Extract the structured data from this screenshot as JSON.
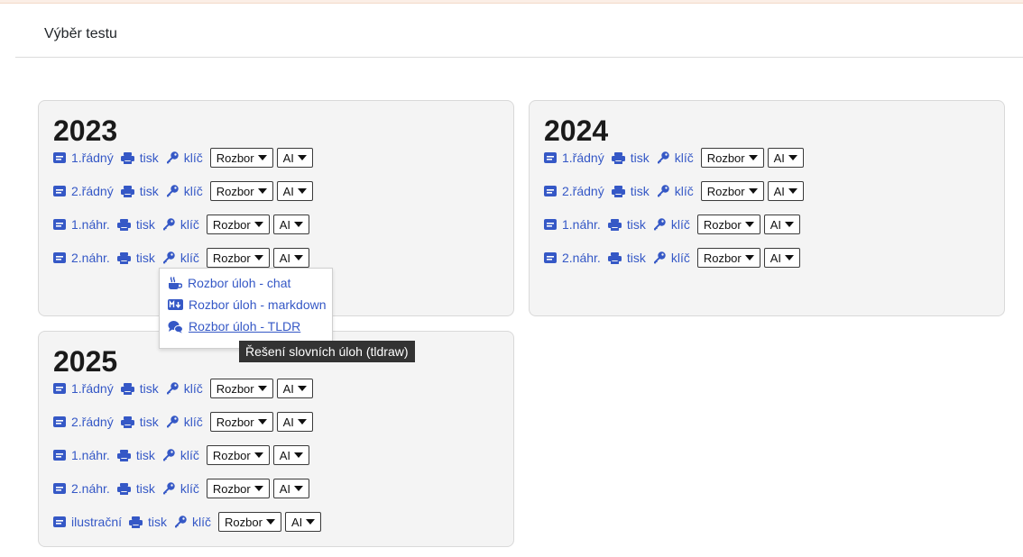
{
  "page": {
    "title": "Výběr testu"
  },
  "labels": {
    "tisk": "tisk",
    "klic": "klíč",
    "rozbor": "Rozbor",
    "ai": "AI"
  },
  "years": {
    "y2023": {
      "year": "2023",
      "tests": [
        "1.řádný",
        "2.řádný",
        "1.náhr.",
        "2.náhr."
      ]
    },
    "y2024": {
      "year": "2024",
      "tests": [
        "1.řádný",
        "2.řádný",
        "1.náhr.",
        "2.náhr."
      ]
    },
    "y2025": {
      "year": "2025",
      "tests": [
        "1.řádný",
        "2.řádný",
        "1.náhr.",
        "2.náhr.",
        "ilustrační"
      ]
    }
  },
  "rozbor_menu": {
    "items": [
      "Rozbor úloh - chat",
      "Rozbor úloh - markdown",
      "Rozbor úloh - TLDR"
    ],
    "icons": [
      "coffee-icon",
      "markdown-icon",
      "comments-icon"
    ],
    "hovered_index": 2
  },
  "tooltip": {
    "text": "Řešení slovních úloh (tldraw)"
  },
  "colors": {
    "link": "#3558c6",
    "card_bg": "#f4f4f4",
    "tooltip_bg": "#333333"
  }
}
